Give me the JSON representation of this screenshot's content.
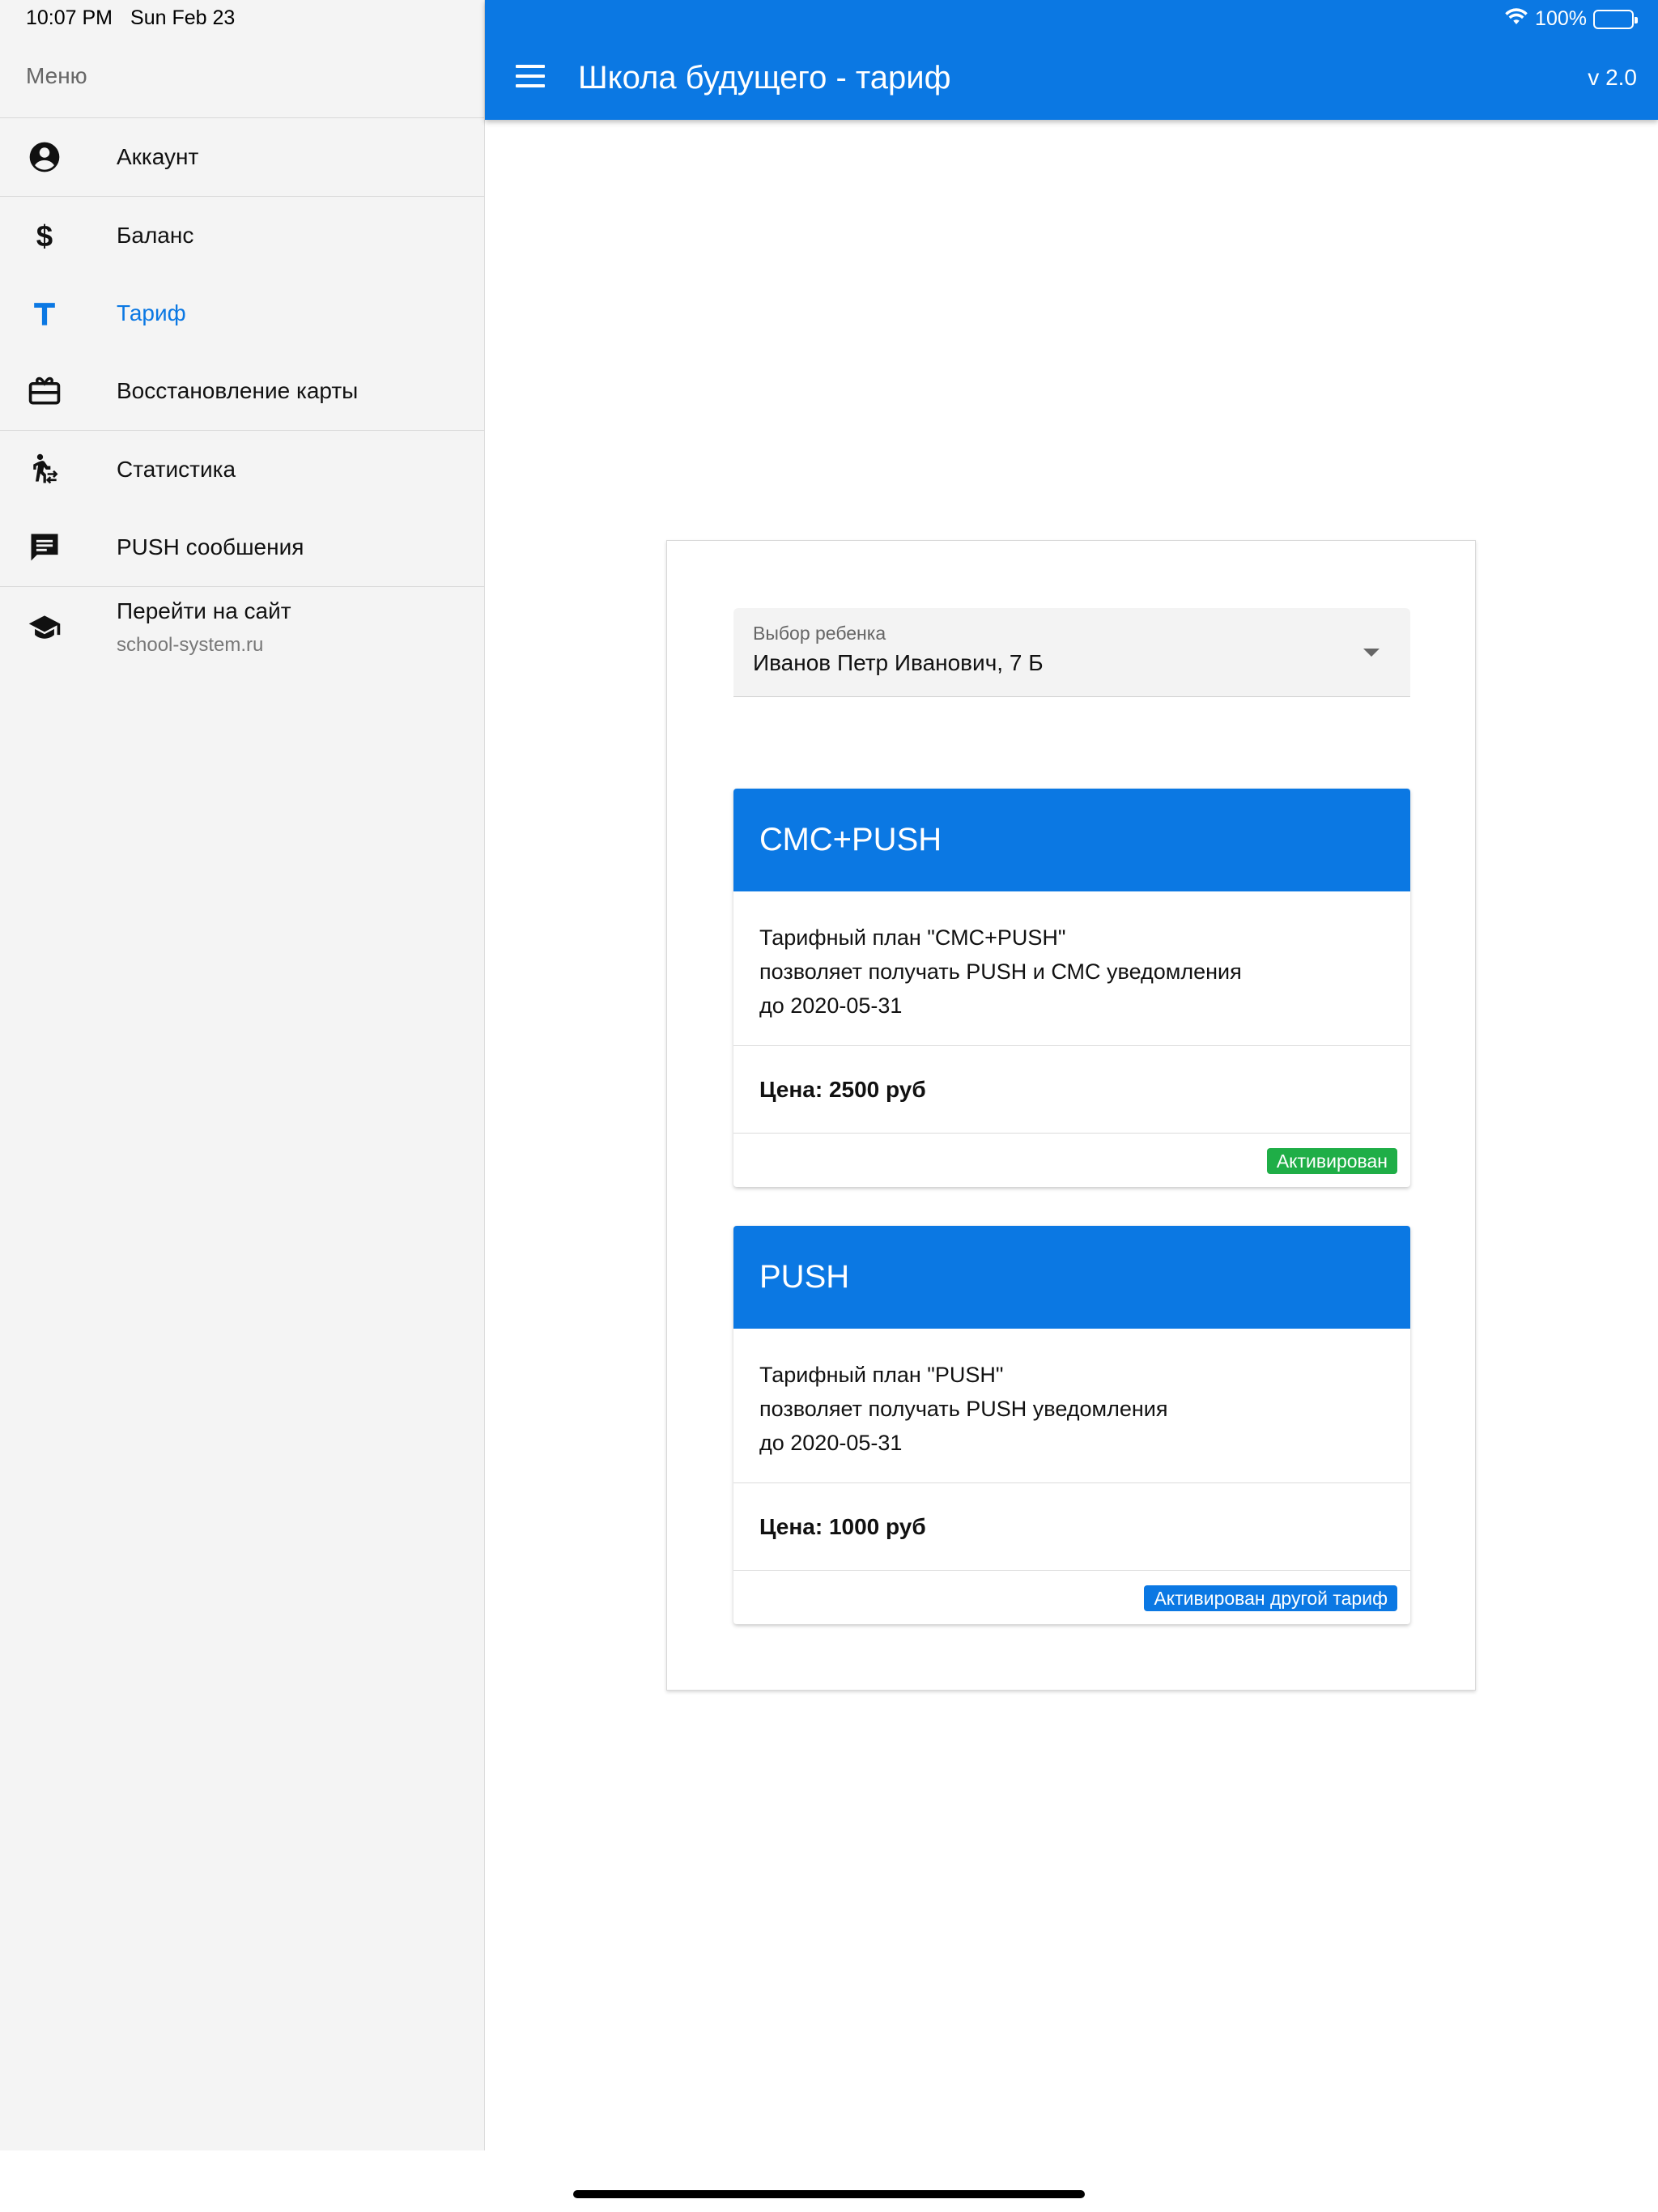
{
  "status_bar": {
    "time": "10:07 PM",
    "date": "Sun Feb 23",
    "battery": "100%"
  },
  "sidebar": {
    "title": "Меню",
    "items": [
      {
        "label": "Аккаунт",
        "icon": "account-circle-icon"
      },
      {
        "label": "Баланс",
        "icon": "dollar-icon"
      },
      {
        "label": "Тариф",
        "icon": "tariff-t-icon",
        "active": true
      },
      {
        "label": "Восстановление карты",
        "icon": "card-gift-icon"
      },
      {
        "label": "Статистика",
        "icon": "walk-stats-icon"
      },
      {
        "label": "PUSH сообшения",
        "icon": "message-icon"
      },
      {
        "label": "Перейти на сайт",
        "sub": "school-system.ru",
        "icon": "school-cap-icon"
      }
    ]
  },
  "header": {
    "title": "Школа будущего - тариф",
    "version": "v 2.0"
  },
  "child_select": {
    "label": "Выбор ребенка",
    "value": "Иванов Петр Иванович, 7 Б"
  },
  "tariffs": [
    {
      "name": "СМС+PUSH",
      "line1": "Тарифный план \"СМС+PUSH\"",
      "line2": "позволяет получать PUSH и СМС уведомления",
      "line3": "до 2020-05-31",
      "price": "Цена: 2500 руб",
      "status": "Активирован",
      "status_color": "#1fae47"
    },
    {
      "name": "PUSH",
      "line1": "Тарифный план \"PUSH\"",
      "line2": "позволяет получать PUSH уведомления",
      "line3": "до 2020-05-31",
      "price": "Цена: 1000 руб",
      "status": "Активирован другой тариф",
      "status_color": "#0b78e3"
    }
  ],
  "colors": {
    "accent": "#0b78e3",
    "success": "#1fae47",
    "sidebar_bg": "#f4f4f4"
  }
}
